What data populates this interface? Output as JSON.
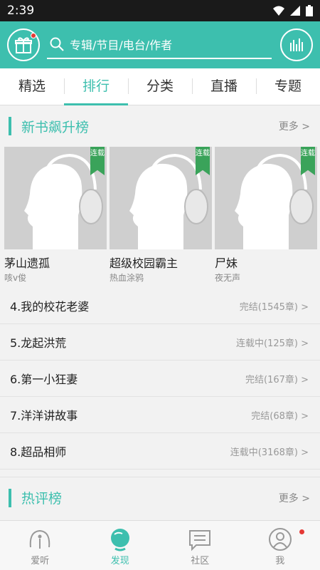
{
  "status": {
    "time": "2:39"
  },
  "header": {
    "search_placeholder": "专辑/节目/电台/作者"
  },
  "tabs": [
    {
      "label": "精选"
    },
    {
      "label": "排行"
    },
    {
      "label": "分类"
    },
    {
      "label": "直播"
    },
    {
      "label": "专题"
    }
  ],
  "active_tab": "排行",
  "section1": {
    "title": "新书飙升榜",
    "more": "更多 >",
    "books": [
      {
        "title": "茅山遗孤",
        "author": "咳v俊",
        "badge": "连载"
      },
      {
        "title": "超级校园霸主",
        "author": "热血涂鸦",
        "badge": "连载"
      },
      {
        "title": "尸妹",
        "author": "夜无声",
        "badge": "连载"
      }
    ],
    "list": [
      {
        "name": "4.我的校花老婆",
        "status": "完结(1545章) >"
      },
      {
        "name": "5.龙起洪荒",
        "status": "连载中(125章) >"
      },
      {
        "name": "6.第一小狂妻",
        "status": "完结(167章) >"
      },
      {
        "name": "7.洋洋讲故事",
        "status": "完结(68章) >"
      },
      {
        "name": "8.超品相师",
        "status": "连载中(3168章) >"
      }
    ]
  },
  "section2": {
    "title": "热评榜",
    "more": "更多 >"
  },
  "bottom_nav": [
    {
      "label": "爱听"
    },
    {
      "label": "发现"
    },
    {
      "label": "社区"
    },
    {
      "label": "我"
    }
  ],
  "colors": {
    "accent": "#3dbfae",
    "badge": "#3aa35a",
    "notify": "#e53935"
  }
}
